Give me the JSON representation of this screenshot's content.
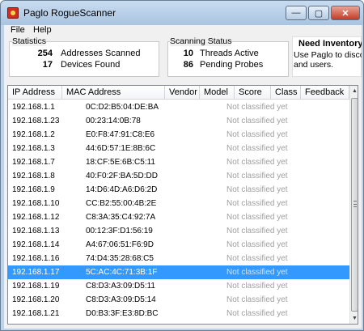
{
  "window": {
    "title": "Paglo RogueScanner",
    "controls": {
      "minimize": "—",
      "maximize": "▢",
      "close": "✕"
    }
  },
  "menu": [
    "File",
    "Help"
  ],
  "statistics": {
    "title": "Statistics",
    "addresses_scanned": "254",
    "addresses_scanned_label": "Addresses Scanned",
    "devices_found": "17",
    "devices_found_label": "Devices Found"
  },
  "scanning_status": {
    "title": "Scanning Status",
    "threads_active": "10",
    "threads_active_label": "Threads Active",
    "pending_probes": "86",
    "pending_probes_label": "Pending Probes"
  },
  "inventory": {
    "title": "Need Inventory",
    "line1": "Use Paglo to disco",
    "line2": "and users."
  },
  "table": {
    "columns": [
      "IP Address",
      "MAC Address",
      "Vendor",
      "Model",
      "Score",
      "Class",
      "Feedback"
    ],
    "rows": [
      {
        "ip": "192.168.1.1",
        "mac": "0C:D2:B5:04:DE:BA",
        "status": "Not classified yet"
      },
      {
        "ip": "192.168.1.23",
        "mac": "00:23:14:0B:78",
        "status": "Not classified yet"
      },
      {
        "ip": "192.168.1.2",
        "mac": "E0:F8:47:91:C8:E6",
        "status": "Not classified yet"
      },
      {
        "ip": "192.168.1.3",
        "mac": "44:6D:57:1E:8B:6C",
        "status": "Not classified yet"
      },
      {
        "ip": "192.168.1.7",
        "mac": "18:CF:5E:6B:C5:11",
        "status": "Not classified yet"
      },
      {
        "ip": "192.168.1.8",
        "mac": "40:F0:2F:BA:5D:DD",
        "status": "Not classified yet"
      },
      {
        "ip": "192.168.1.9",
        "mac": "14:D6:4D:A6:D6:2D",
        "status": "Not classified yet"
      },
      {
        "ip": "192.168.1.10",
        "mac": "CC:B2:55:00:4B:2E",
        "status": "Not classified yet"
      },
      {
        "ip": "192.168.1.12",
        "mac": "C8:3A:35:C4:92:7A",
        "status": "Not classified yet"
      },
      {
        "ip": "192.168.1.13",
        "mac": "00:12:3F:D1:56:19",
        "status": "Not classified yet"
      },
      {
        "ip": "192.168.1.14",
        "mac": "A4:67:06:51:F6:9D",
        "status": "Not classified yet"
      },
      {
        "ip": "192.168.1.16",
        "mac": "74:D4:35:28:68:C5",
        "status": "Not classified yet"
      },
      {
        "ip": "192.168.1.17",
        "mac": "5C:AC:4C:71:3B:1F",
        "status": "Not classified yet",
        "selected": true
      },
      {
        "ip": "192.168.1.19",
        "mac": "C8:D3:A3:09:D5:11",
        "status": "Not classified yet"
      },
      {
        "ip": "192.168.1.20",
        "mac": "C8:D3:A3:09:D5:14",
        "status": "Not classified yet"
      },
      {
        "ip": "192.168.1.21",
        "mac": "D0:B3:3F:E3:8D:BC",
        "status": "Not classified yet"
      }
    ]
  },
  "colors": {
    "selection": "#3399ff",
    "titlebar": "#bcd3ea",
    "status_text": "#a0a0a0"
  }
}
